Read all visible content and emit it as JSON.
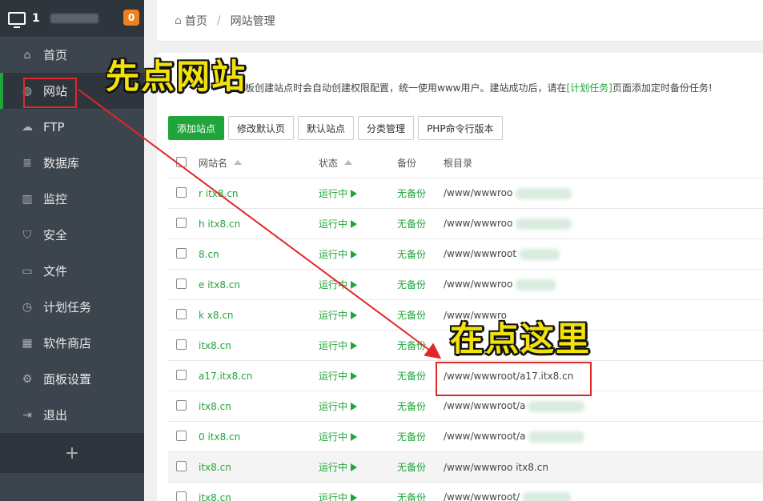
{
  "sidebar": {
    "host": "1",
    "badge": "0",
    "items": [
      {
        "label": "首页",
        "icon": "home-icon",
        "glyph": "⌂"
      },
      {
        "label": "网站",
        "icon": "globe-icon",
        "glyph": "◍",
        "active": true
      },
      {
        "label": "FTP",
        "icon": "ftp-icon",
        "glyph": "☁"
      },
      {
        "label": "数据库",
        "icon": "database-icon",
        "glyph": "≣"
      },
      {
        "label": "监控",
        "icon": "monitor-chart-icon",
        "glyph": "▥"
      },
      {
        "label": "安全",
        "icon": "shield-icon",
        "glyph": "⛉"
      },
      {
        "label": "文件",
        "icon": "folder-icon",
        "glyph": "▭"
      },
      {
        "label": "计划任务",
        "icon": "clock-icon",
        "glyph": "◷"
      },
      {
        "label": "软件商店",
        "icon": "grid-icon",
        "glyph": "▦"
      },
      {
        "label": "面板设置",
        "icon": "gear-icon",
        "glyph": "⚙"
      },
      {
        "label": "退出",
        "icon": "logout-icon",
        "glyph": "⇥"
      }
    ],
    "add": "+"
  },
  "breadcrumb": {
    "home": "首页",
    "sep": "/",
    "current": "网站管理"
  },
  "notice": {
    "pre": "板创建站点时会自动创建权限配置，统一使用www用户。建站成功后，请在",
    "link": "[计划任务]",
    "post": "页面添加定时备份任务!"
  },
  "toolbar": [
    "添加站点",
    "修改默认页",
    "默认站点",
    "分类管理",
    "PHP命令行版本"
  ],
  "table": {
    "headers": {
      "name": "网站名",
      "status": "状态",
      "backup": "备份",
      "root": "根目录"
    },
    "rows": [
      {
        "name": "r    itx8.cn",
        "status": "运行中",
        "backup": "无备份",
        "root": "/www/wwwroo",
        "blur": 70
      },
      {
        "name": "h    itx8.cn",
        "status": "运行中",
        "backup": "无备份",
        "root": "/www/wwwroo",
        "blur": 70
      },
      {
        "name": "      8.cn",
        "status": "运行中",
        "backup": "无备份",
        "root": "/www/wwwroot",
        "blur": 50
      },
      {
        "name": "e    itx8.cn",
        "status": "运行中",
        "backup": "无备份",
        "root": "/www/wwwroo",
        "blur": 50
      },
      {
        "name": "    k   x8.cn",
        "status": "运行中",
        "backup": "无备份",
        "root": "/www/wwwro",
        "blur": 0
      },
      {
        "name": "      itx8.cn",
        "status": "运行中",
        "backup": "无备份",
        "root": "",
        "blur": 0
      },
      {
        "name": "a17.itx8.cn",
        "status": "运行中",
        "backup": "无备份",
        "root": "/www/wwwroot/a17.itx8.cn",
        "blur": 0
      },
      {
        "name": "      itx8.cn",
        "status": "运行中",
        "backup": "无备份",
        "root": "/www/wwwroot/a",
        "blur": 70
      },
      {
        "name": "  0   itx8.cn",
        "status": "运行中",
        "backup": "无备份",
        "root": "/www/wwwroot/a",
        "blur": 70
      },
      {
        "name": "      itx8.cn",
        "status": "运行中",
        "backup": "无备份",
        "root": "/www/wwwroo      itx8.cn",
        "blur": 0,
        "shade": true
      },
      {
        "name": "      itx8.cn",
        "status": "运行中",
        "backup": "无备份",
        "root": "/www/wwwroot/",
        "blur": 60
      }
    ]
  },
  "annotations": {
    "step1": "先点网站",
    "step2": "在点这里"
  },
  "colors": {
    "accent": "#20a53a",
    "annotation": "#f2e20a",
    "highlight": "#e02828"
  }
}
